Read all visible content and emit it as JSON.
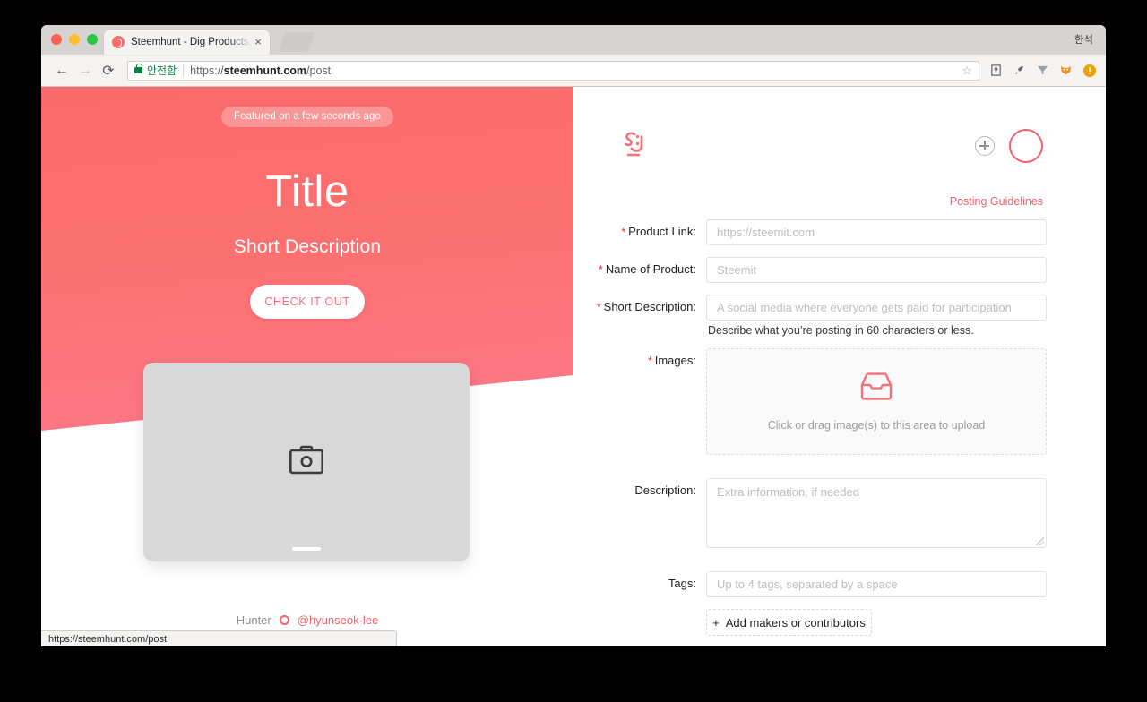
{
  "browser": {
    "tab_title": "Steemhunt - Dig Products, Ear",
    "tab_close_glyph": "×",
    "language_label": "한석",
    "back_glyph": "←",
    "forward_glyph": "→",
    "reload_glyph": "⟳",
    "secure_label": "안전함",
    "url_scheme": "https://",
    "url_host": "steemhunt.com",
    "url_path": "/post",
    "star_glyph": "☆",
    "extensions": [
      "shield-icon",
      "rocket-icon",
      "funnel-icon",
      "fox-icon",
      "alert-icon"
    ],
    "status_url": "https://steemhunt.com/post"
  },
  "hero": {
    "badge": "Featured on a few seconds ago",
    "title": "Title",
    "subtitle": "Short Description",
    "cta": "CHECK IT OUT",
    "placeholder_icon": "camera-icon",
    "hunter_label": "Hunter",
    "hunter_name": "@hyunseok-lee",
    "gradient_top": "#fa6a6a",
    "gradient_bottom": "#fb7e96"
  },
  "form": {
    "logo_text": "S:h",
    "add_glyph": "+",
    "guidelines_link": "Posting Guidelines",
    "accent_color": "#f4606b",
    "required_mark": "*",
    "fields": [
      {
        "label": "Product Link",
        "required": true,
        "placeholder": "https://steemit.com"
      },
      {
        "label": "Name of Product",
        "required": true,
        "placeholder": "Steemit"
      },
      {
        "label": "Short Description",
        "required": true,
        "placeholder": "A social media where everyone gets paid for participation"
      },
      {
        "label": "Images",
        "required": true,
        "placeholder": ""
      },
      {
        "label": "Description",
        "required": false,
        "placeholder": "Extra information, if needed"
      },
      {
        "label": "Tags",
        "required": false,
        "placeholder": "Up to 4 tags, separated by a space"
      }
    ],
    "short_description_hint": "Describe what you’re posting in 60 characters or less.",
    "dropzone_text": "Click or drag image(s) to this area to upload",
    "dropzone_icon": "inbox-icon",
    "makers_button": "Add makers or contributors",
    "makers_plus": "+",
    "colon": ":"
  }
}
